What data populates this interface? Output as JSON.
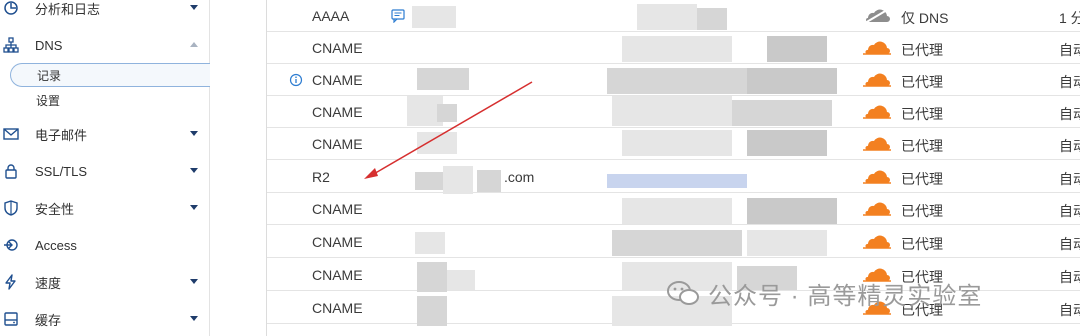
{
  "sidebar": {
    "items": [
      {
        "label": "分析和日志",
        "icon": "clock-chart-icon"
      },
      {
        "label": "DNS",
        "icon": "network-tree-icon"
      },
      {
        "label": "电子邮件",
        "icon": "envelope-icon"
      },
      {
        "label": "SSL/TLS",
        "icon": "lock-icon"
      },
      {
        "label": "安全性",
        "icon": "shield-icon"
      },
      {
        "label": "Access",
        "icon": "access-arrow-icon"
      },
      {
        "label": "速度",
        "icon": "lightning-icon"
      },
      {
        "label": "缓存",
        "icon": "cache-disk-icon"
      }
    ],
    "dns_sub": [
      {
        "label": "记录",
        "active": true
      },
      {
        "label": "设置",
        "active": false
      }
    ]
  },
  "records": [
    {
      "type": "AAAA",
      "name": "",
      "proxy": "仅 DNS",
      "ttl": "1 分",
      "proxied": false
    },
    {
      "type": "CNAME",
      "name": "",
      "proxy": "已代理",
      "ttl": "自动",
      "proxied": true
    },
    {
      "type": "CNAME",
      "name": "",
      "proxy": "已代理",
      "ttl": "自动",
      "proxied": true
    },
    {
      "type": "CNAME",
      "name": "",
      "proxy": "已代理",
      "ttl": "自动",
      "proxied": true
    },
    {
      "type": "CNAME",
      "name": "",
      "proxy": "已代理",
      "ttl": "自动",
      "proxied": true
    },
    {
      "type": "R2",
      "name": ".com",
      "proxy": "已代理",
      "ttl": "自动",
      "proxied": true
    },
    {
      "type": "CNAME",
      "name": "",
      "proxy": "已代理",
      "ttl": "自动",
      "proxied": true
    },
    {
      "type": "CNAME",
      "name": "",
      "proxy": "已代理",
      "ttl": "自动",
      "proxied": true
    },
    {
      "type": "CNAME",
      "name": "",
      "proxy": "已代理",
      "ttl": "自动",
      "proxied": true
    },
    {
      "type": "CNAME",
      "name": "",
      "proxy": "已代理",
      "ttl": "自动",
      "proxied": true
    }
  ],
  "watermark": "公众号 · 高等精灵实验室",
  "colors": {
    "cloud_orange": "#f38020",
    "cloud_gray": "#8d8d8d",
    "arrow_red": "#d62f2f",
    "active_border": "#8fb3dd",
    "link_blue": "#2c7cd1"
  }
}
